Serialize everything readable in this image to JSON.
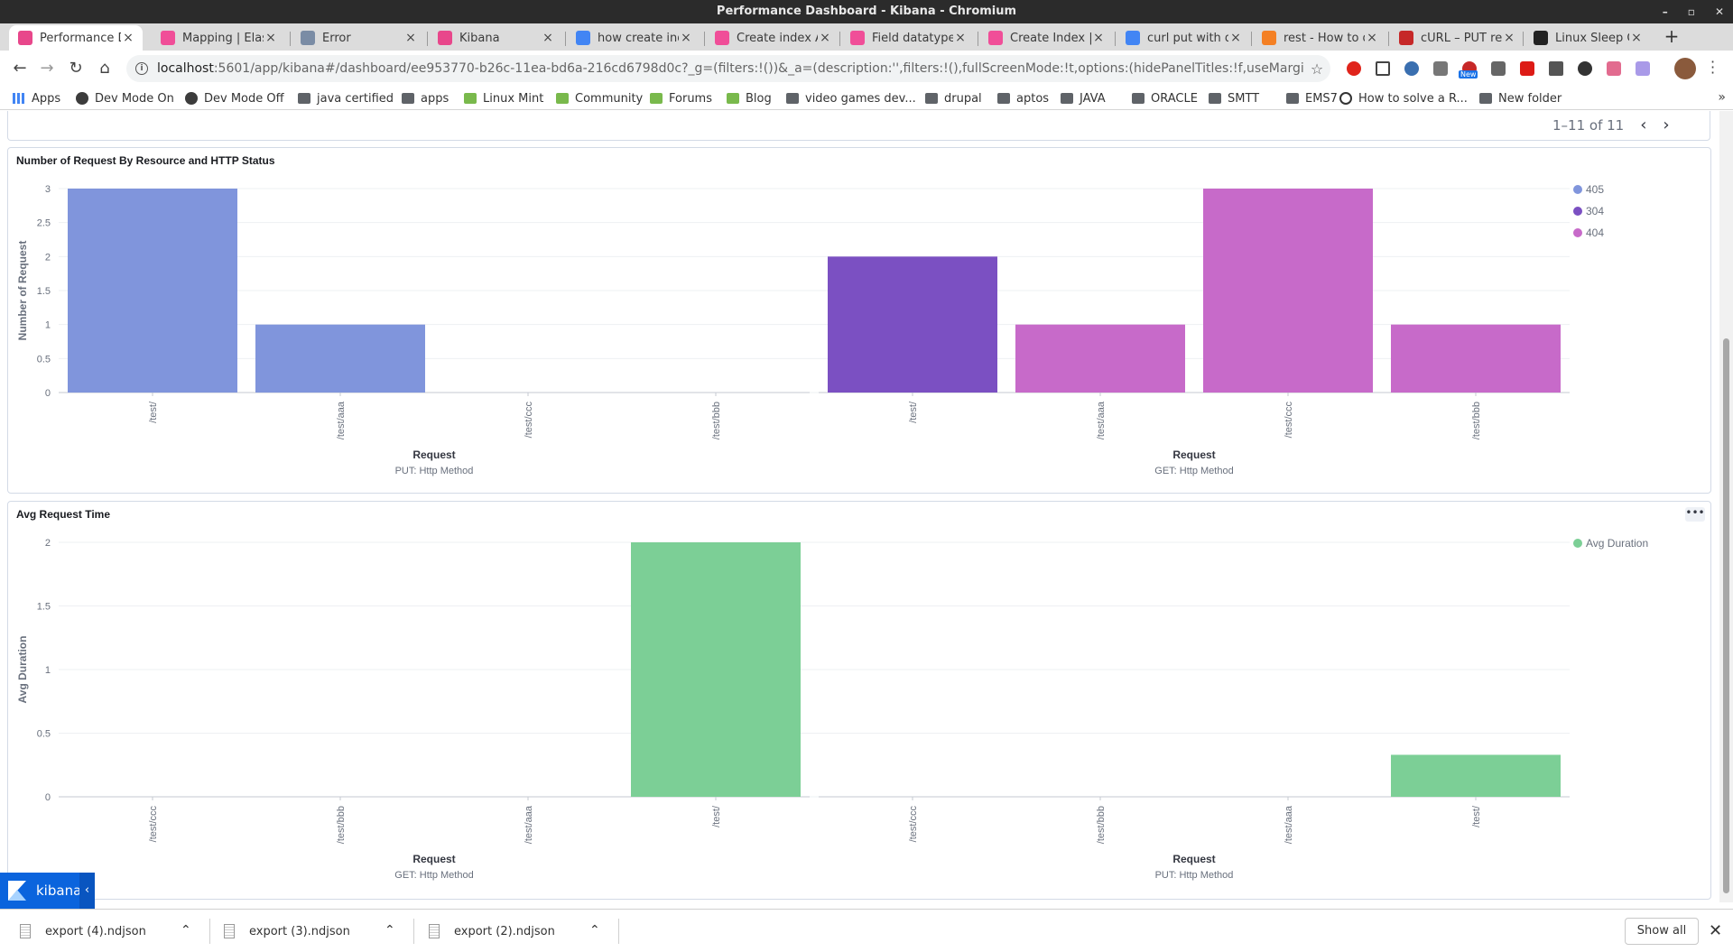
{
  "window": {
    "title": "Performance Dashboard - Kibana - Chromium"
  },
  "tabs": [
    {
      "label": "Performance D",
      "icon": "kibana-icon",
      "color": "#e8478b",
      "active": true
    },
    {
      "label": "Mapping | Elas",
      "icon": "elastic-icon",
      "color": "#f04e98",
      "active": false
    },
    {
      "label": "Error",
      "icon": "error-page-icon",
      "color": "#7a8ca5",
      "active": false
    },
    {
      "label": "Kibana",
      "icon": "kibana-icon",
      "color": "#e8478b",
      "active": false
    },
    {
      "label": "how create ind",
      "icon": "google-icon",
      "color": "#4285f4",
      "active": false
    },
    {
      "label": "Create index A",
      "icon": "elastic-icon",
      "color": "#f04e98",
      "active": false
    },
    {
      "label": "Field datatype",
      "icon": "elastic-icon",
      "color": "#f04e98",
      "active": false
    },
    {
      "label": "Create Index | ",
      "icon": "elastic-icon",
      "color": "#f04e98",
      "active": false
    },
    {
      "label": "curl put with d",
      "icon": "google-icon",
      "color": "#4285f4",
      "active": false
    },
    {
      "label": "rest - How to d",
      "icon": "stackoverflow-icon",
      "color": "#f48024",
      "active": false
    },
    {
      "label": "cURL – PUT re",
      "icon": "curl-icon",
      "color": "#c62828",
      "active": false
    },
    {
      "label": "Linux Sleep Co",
      "icon": "linux-icon",
      "color": "#222222",
      "active": false
    }
  ],
  "toolbar": {
    "url_host": "localhost",
    "url_rest": ":5601/app/kibana#/dashboard/ee953770-b26c-11ea-bd6a-216cd6798d0c?_g=(filters:!())&_a=(description:'',filters:!(),fullScreenMode:!t,options:(hidePanelTitles:!f,useMargins:!t),panels:!((em...",
    "ext_badge": "New"
  },
  "bookmarks": [
    {
      "label": "Apps",
      "icon": "grid"
    },
    {
      "label": "Dev Mode On",
      "icon": "globe"
    },
    {
      "label": "Dev Mode Off",
      "icon": "globe"
    },
    {
      "label": "java certified",
      "icon": "folder"
    },
    {
      "label": "apps",
      "icon": "folder"
    },
    {
      "label": "Linux Mint",
      "icon": "leaf"
    },
    {
      "label": "Community",
      "icon": "leaf"
    },
    {
      "label": "Forums",
      "icon": "leaf"
    },
    {
      "label": "Blog",
      "icon": "leaf"
    },
    {
      "label": "video games dev...",
      "icon": "folder"
    },
    {
      "label": "drupal",
      "icon": "folder"
    },
    {
      "label": "aptos",
      "icon": "folder"
    },
    {
      "label": "JAVA",
      "icon": "folder"
    },
    {
      "label": "ORACLE",
      "icon": "folder"
    },
    {
      "label": "SMTT",
      "icon": "folder"
    },
    {
      "label": "EMS7",
      "icon": "folder"
    },
    {
      "label": "How to solve a R...",
      "icon": "circ"
    },
    {
      "label": "New folder",
      "icon": "folder"
    }
  ],
  "pager": {
    "text": "1–11 of 11"
  },
  "panel1": {
    "title": "Number of Request By Resource and HTTP Status"
  },
  "panel2": {
    "title": "Avg Request Time"
  },
  "chart_data": [
    {
      "type": "bar",
      "title": "Number of Request By Resource and HTTP Status",
      "ylabel": "Number of Request",
      "ylim": [
        0,
        3
      ],
      "yticks": [
        0,
        0.5,
        1,
        1.5,
        2,
        2.5,
        3
      ],
      "legend_position": "top-right",
      "legend": [
        {
          "name": "405",
          "color": "#8095dc"
        },
        {
          "name": "304",
          "color": "#7b50c2"
        },
        {
          "name": "404",
          "color": "#c76ac9"
        }
      ],
      "groups": [
        {
          "xlabel": "Request",
          "sublabel": "PUT: Http Method",
          "categories": [
            "/test/",
            "/test/aaa",
            "/test/ccc",
            "/test/bbb"
          ],
          "bars": [
            {
              "value": 3,
              "series": "405"
            },
            {
              "value": 1,
              "series": "405"
            },
            null,
            null
          ]
        },
        {
          "xlabel": "Request",
          "sublabel": "GET: Http Method",
          "categories": [
            "/test/",
            "/test/aaa",
            "/test/ccc",
            "/test/bbb"
          ],
          "bars": [
            {
              "value": 2,
              "series": "304"
            },
            {
              "value": 1,
              "series": "404"
            },
            {
              "value": 3,
              "series": "404"
            },
            {
              "value": 1,
              "series": "404"
            }
          ]
        }
      ]
    },
    {
      "type": "bar",
      "title": "Avg Request Time",
      "ylabel": "Avg Duration",
      "ylim": [
        0,
        2
      ],
      "yticks": [
        0,
        0.5,
        1,
        1.5,
        2
      ],
      "legend_position": "top-right",
      "legend": [
        {
          "name": "Avg Duration",
          "color": "#7ccf96"
        }
      ],
      "groups": [
        {
          "xlabel": "Request",
          "sublabel": "GET: Http Method",
          "categories": [
            "/test/ccc",
            "/test/bbb",
            "/test/aaa",
            "/test/"
          ],
          "bars": [
            null,
            null,
            null,
            {
              "value": 2,
              "series": "Avg Duration"
            }
          ]
        },
        {
          "xlabel": "Request",
          "sublabel": "PUT: Http Method",
          "categories": [
            "/test/ccc",
            "/test/bbb",
            "/test/aaa",
            "/test/"
          ],
          "bars": [
            null,
            null,
            null,
            {
              "value": 0.33,
              "series": "Avg Duration"
            }
          ]
        }
      ]
    }
  ],
  "kibana_badge": {
    "label": "kibana",
    "collapse": "‹"
  },
  "downloads": [
    {
      "name": "export (4).ndjson"
    },
    {
      "name": "export (3).ndjson"
    },
    {
      "name": "export (2).ndjson"
    }
  ],
  "shelf": {
    "show_all": "Show all"
  }
}
